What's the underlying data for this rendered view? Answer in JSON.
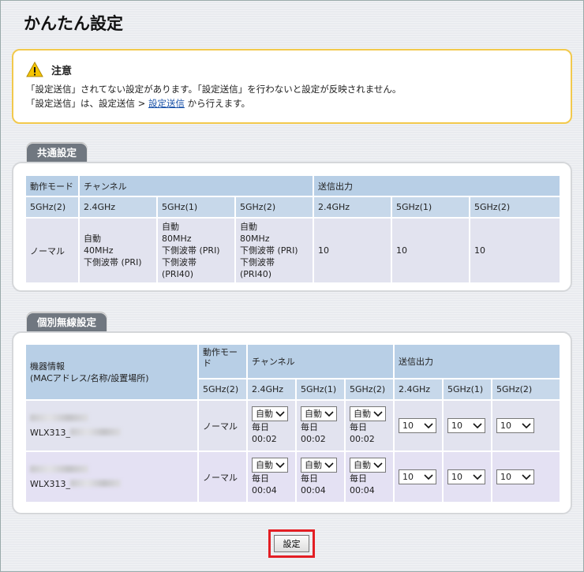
{
  "page": {
    "title": "かんたん設定"
  },
  "notice": {
    "title": "注意",
    "line1": "「設定送信」されてない設定があります。「設定送信」を行わないと設定が反映されません。",
    "line2_before": "「設定送信」は、設定送信 > ",
    "line2_link": "設定送信",
    "line2_after": " から行えます。",
    "icon": "warning-icon"
  },
  "common": {
    "label": "共通設定",
    "headers": {
      "mode": "動作モード",
      "channel": "チャンネル",
      "power": "送信出力"
    },
    "sub": [
      "5GHz(2)",
      "2.4GHz",
      "5GHz(1)",
      "5GHz(2)",
      "2.4GHz",
      "5GHz(1)",
      "5GHz(2)"
    ],
    "row": {
      "mode": "ノーマル",
      "ch24": [
        "自動",
        "40MHz",
        "下側波帯 (PRI)"
      ],
      "ch5g1": [
        "自動",
        "80MHz",
        "下側波帯 (PRI)",
        "下側波帯 (PRI40)"
      ],
      "ch5g2": [
        "自動",
        "80MHz",
        "下側波帯 (PRI)",
        "下側波帯 (PRI40)"
      ],
      "p24": "10",
      "p5g1": "10",
      "p5g2": "10"
    }
  },
  "individual": {
    "label": "個別無線設定",
    "headers": {
      "device_line1": "機器情報",
      "device_line2": "(MACアドレス/名称/設置場所)",
      "mode": "動作モード",
      "channel": "チャンネル",
      "power": "送信出力"
    },
    "sub": [
      "5GHz(2)",
      "2.4GHz",
      "5GHz(1)",
      "5GHz(2)",
      "2.4GHz",
      "5GHz(1)",
      "5GHz(2)"
    ],
    "rows": [
      {
        "device_prefix": "WLX313_",
        "mode": "ノーマル",
        "ch": [
          "自動",
          "自動",
          "自動"
        ],
        "schedule": "毎日",
        "time": "00:02",
        "power": [
          "10",
          "10",
          "10"
        ]
      },
      {
        "device_prefix": "WLX313_",
        "mode": "ノーマル",
        "ch": [
          "自動",
          "自動",
          "自動"
        ],
        "schedule": "毎日",
        "time": "00:04",
        "power": [
          "10",
          "10",
          "10"
        ]
      }
    ]
  },
  "actions": {
    "submit": "設定"
  },
  "colors": {
    "accent_border": "#e31e24",
    "notice_border": "#f2c94c",
    "link": "#1a52a8"
  }
}
